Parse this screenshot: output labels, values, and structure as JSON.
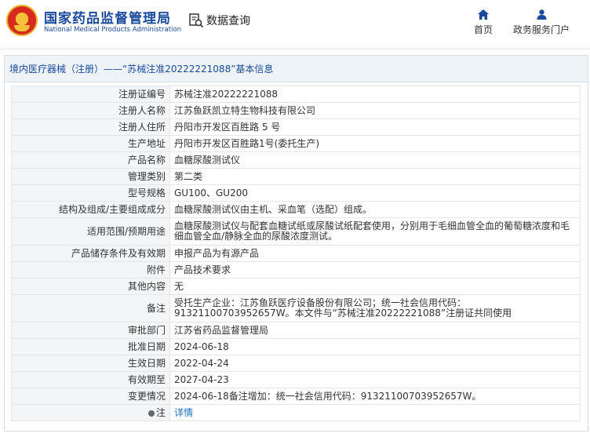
{
  "header": {
    "brand_cn": "国家药品监督管理局",
    "brand_en": "National Medical Products Administration",
    "query_label": "数据查询",
    "nav_home": "首页",
    "nav_gov": "政务服务门户"
  },
  "panel": {
    "title": "境内医疗器械（注册）——“苏械注准20222221088”基本信息"
  },
  "rows": [
    {
      "label": "注册证编号",
      "value": "苏械注准20222221088"
    },
    {
      "label": "注册人名称",
      "value": "江苏鱼跃凯立特生物科技有限公司"
    },
    {
      "label": "注册人住所",
      "value": "丹阳市开发区百胜路 5 号"
    },
    {
      "label": "生产地址",
      "value": "丹阳市开发区百胜路1号(委托生产)"
    },
    {
      "label": "产品名称",
      "value": "血糖尿酸测试仪"
    },
    {
      "label": "管理类别",
      "value": "第二类"
    },
    {
      "label": "型号规格",
      "value": "GU100、GU200"
    },
    {
      "label": "结构及组成/主要组成成分",
      "value": "血糖尿酸测试仪由主机、采血笔（选配）组成。"
    },
    {
      "label": "适用范围/预期用途",
      "value": "血糖尿酸测试仪与配套血糖试纸或尿酸试纸配套使用，分别用于毛细血管全血的葡萄糖浓度和毛细血管全血/静脉全血的尿酸浓度测试。"
    },
    {
      "label": "产品储存条件及有效期",
      "value": "申报产品为有源产品"
    },
    {
      "label": "附件",
      "value": "产品技术要求"
    },
    {
      "label": "其他内容",
      "value": "无"
    },
    {
      "label": "备注",
      "value": "受托生产企业：江苏鱼跃医疗设备股份有限公司；统一社会信用代码：91321100703952657W。本文件与“苏械注准20222221088”注册证共同使用"
    },
    {
      "label": "审批部门",
      "value": "江苏省药品监督管理局"
    },
    {
      "label": "批准日期",
      "value": "2024-06-18"
    },
    {
      "label": "生效日期",
      "value": "2022-04-24"
    },
    {
      "label": "有效期至",
      "value": "2027-04-23"
    },
    {
      "label": "变更情况",
      "value": "2024-06-18备注增加：统一社会信用代码：91321100703952657W。"
    },
    {
      "label": "注",
      "value": "详情"
    }
  ]
}
